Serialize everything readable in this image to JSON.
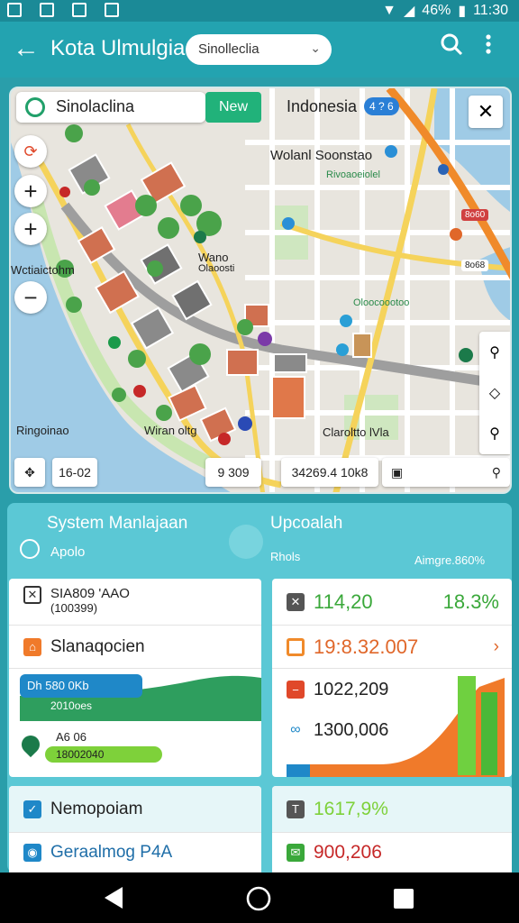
{
  "status_bar": {
    "battery": "46%",
    "time": "11:30"
  },
  "app_bar": {
    "title": "Kota Ulmulgia",
    "search_value": "Sinolleclia"
  },
  "map": {
    "search_value": "Sinolaclina",
    "new_label": "New",
    "labels": {
      "indonesia": "Indonesia",
      "badge": "4 ? 6",
      "poi_top": "Wolanl Soonstao",
      "poi_top_sub": "Rivoaoeiolel",
      "left": "Wctiaictohm",
      "center": "Wano",
      "center_sub": "Olaoosti",
      "right_mid": "Oloocoootoo",
      "bottom_left": "Ringoinao",
      "bottom_mid": "Wiran oltg",
      "bottom_right": "Claroltto lVla",
      "right_tag_1": "8o60",
      "right_tag_2": "8o68"
    },
    "chips": {
      "coord": "16-02",
      "distance": "9 309",
      "measure": "34269.4 10k8"
    }
  },
  "dashboard": {
    "left_head": "System Manlajaan",
    "left_sub": "Apolo",
    "right_head": "Upcoalah",
    "right_sub": "Rhols",
    "right_pct": "Aimgre.860%",
    "left_card": {
      "row1_title": "SIA809 'AAO",
      "row1_sub": "(100399)",
      "row2": "Slanaqocien",
      "bar1": "Dh 580 0Kb",
      "bar2": "2010oes",
      "pin_label": "A6 06",
      "pin_bar": "18002040"
    },
    "right_card": {
      "row1_value": "114,20",
      "row1_pct": "18.3%",
      "row2": "19:8.32.007",
      "row3": "1022,209",
      "row4": "1300,006"
    },
    "bottom_left": {
      "row1": "Nemopoiam",
      "row2": "Geraalmog P4A"
    },
    "bottom_right": {
      "row1": "1617,9%",
      "row2": "900,206"
    }
  },
  "colors": {
    "teal": "#23a3b0",
    "green": "#21b27a",
    "orange": "#f07a2a",
    "red": "#c62828"
  }
}
